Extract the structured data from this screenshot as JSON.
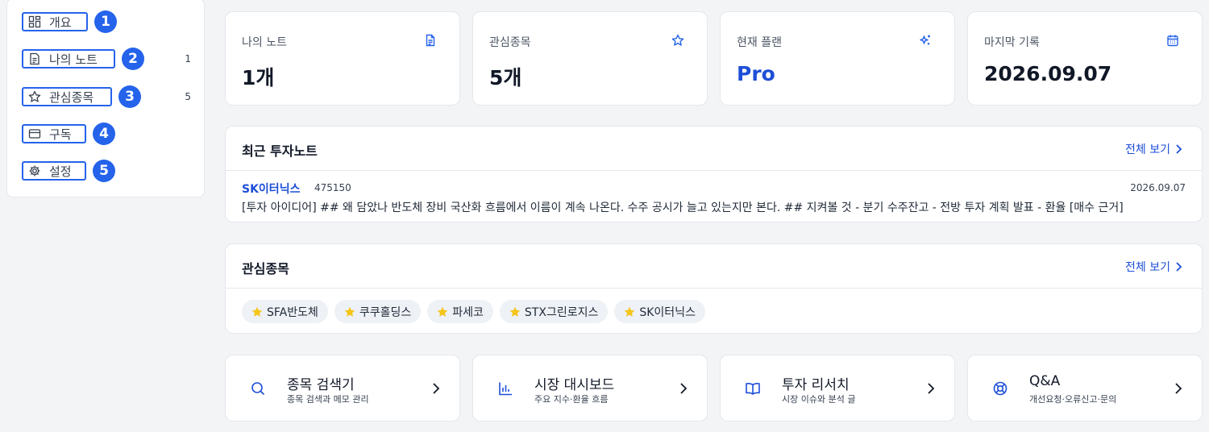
{
  "sidebar": {
    "items": [
      {
        "label": "개요",
        "num": "1",
        "count": "",
        "icon": "grid-icon"
      },
      {
        "label": "나의 노트",
        "num": "2",
        "count": "1",
        "icon": "note-icon"
      },
      {
        "label": "관심종목",
        "num": "3",
        "count": "5",
        "icon": "star-icon"
      },
      {
        "label": "구독",
        "num": "4",
        "count": "",
        "icon": "card-icon"
      },
      {
        "label": "설정",
        "num": "5",
        "count": "",
        "icon": "gear-icon"
      }
    ]
  },
  "stats": [
    {
      "label": "나의 노트",
      "value": "1개",
      "icon": "document-icon"
    },
    {
      "label": "관심종목",
      "value": "5개",
      "icon": "star-icon"
    },
    {
      "label": "현재 플랜",
      "value": "Pro",
      "icon": "sparkle-icon",
      "accent": "#1d4ed8"
    },
    {
      "label": "마지막 기록",
      "value": "2026.09.07",
      "icon": "calendar-icon"
    }
  ],
  "recent_notes": {
    "title": "최근 투자노트",
    "see_all": "전체 보기",
    "items": [
      {
        "name": "SK이터닉스",
        "code": "475150",
        "date": "2026.09.07",
        "body": "[투자 아이디어] ## 왜 담았나 반도체 장비 국산화 흐름에서 이름이 계속 나온다. 수주 공시가 늘고 있는지만 본다. ## 지켜볼 것 - 분기 수주잔고 - 전방 투자 계획 발표 - 환율 [매수 근거]"
      }
    ]
  },
  "watchlist": {
    "title": "관심종목",
    "see_all": "전체 보기",
    "chips": [
      "SFA반도체",
      "쿠쿠홀딩스",
      "파세코",
      "STX그린로지스",
      "SK이터닉스"
    ],
    "star_color": "#f5c518"
  },
  "quick_links": [
    {
      "title": "종목 검색기",
      "sub": "종목 검색과 메모 관리",
      "icon": "search-icon"
    },
    {
      "title": "시장 대시보드",
      "sub": "주요 지수·환율 흐름",
      "icon": "bar-chart-icon"
    },
    {
      "title": "투자 리서치",
      "sub": "시장 이슈와 분석 글",
      "icon": "book-icon"
    },
    {
      "title": "Q&A",
      "sub": "개선요청·오류신고·문의",
      "icon": "lifebuoy-icon"
    }
  ],
  "colors": {
    "accent": "#2563eb",
    "link": "#1d4ed8"
  }
}
